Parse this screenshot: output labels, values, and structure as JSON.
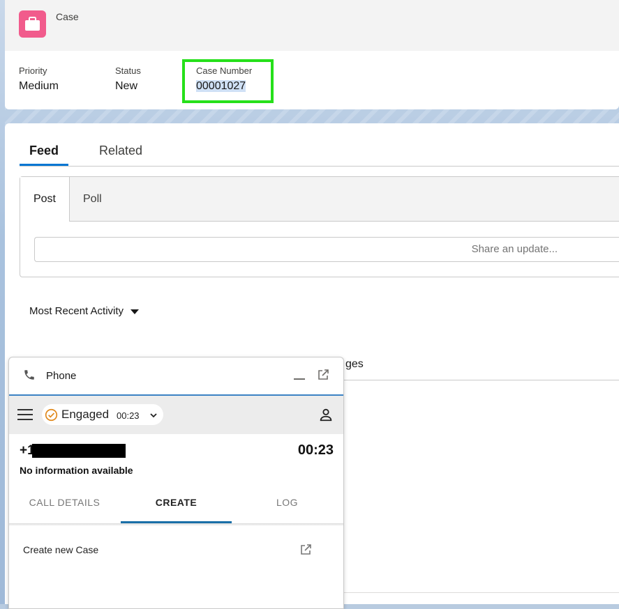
{
  "header": {
    "object_label": "Case",
    "fields": [
      {
        "label": "Priority",
        "value": "Medium"
      },
      {
        "label": "Status",
        "value": "New"
      },
      {
        "label": "Case Number",
        "value": "00001027"
      }
    ],
    "icon": "briefcase-icon",
    "icon_color": "#f15b8c",
    "highlight_color": "#26e01a"
  },
  "tabs": {
    "feed": "Feed",
    "related": "Related"
  },
  "publisher": {
    "post": "Post",
    "poll": "Poll",
    "placeholder": "Share an update..."
  },
  "activity": {
    "sort_label": "Most Recent Activity"
  },
  "background_tab_fragment": "ges",
  "phone": {
    "title": "Phone",
    "state": "Engaged",
    "state_timer": "00:23",
    "caller_number": "+1",
    "call_timer": "00:23",
    "caller_info": "No information available",
    "tabs": [
      "CALL DETAILS",
      "CREATE",
      "LOG"
    ],
    "active_tab": "CREATE",
    "create_item": "Create new Case",
    "accent": "#1a6fa8"
  }
}
